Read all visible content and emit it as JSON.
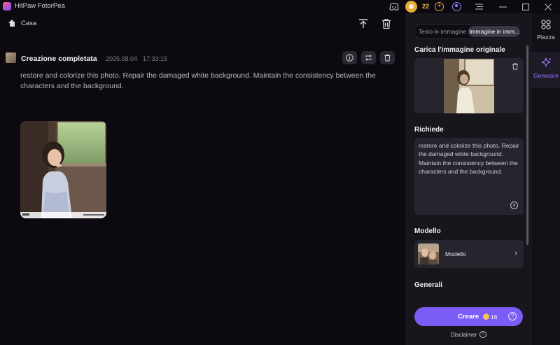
{
  "window": {
    "title": "HitPaw FotorPea",
    "credits": "22"
  },
  "breadcrumb": {
    "home_label": "Casa"
  },
  "generation": {
    "title": "Creazione completata",
    "date": "2025.08.04",
    "time": "17:33:15",
    "prompt": "restore and colorize this photo. Repair the damaged white background. Maintain the consistency between the characters and the background."
  },
  "panel": {
    "tabs": [
      {
        "label": "Testo in immagine",
        "active": false
      },
      {
        "label": "Immagine in imm...",
        "active": true
      }
    ],
    "upload_title": "Carica l'immagine originale",
    "prompt_title": "Richiede",
    "prompt_text": "restore and colorize this photo. Repair the damaged white background. Maintain the consistency between the characters and the background.",
    "model_title": "Modello",
    "model_label": "Modello",
    "general_title": "Generali",
    "create_label": "Creare",
    "create_cost": "16",
    "disclaimer": "Disclaimer"
  },
  "rail": {
    "items": [
      {
        "label": "Piazza",
        "active": false
      },
      {
        "label": "Generare",
        "active": true
      }
    ]
  },
  "colors": {
    "accent": "#7c5cf6",
    "coin": "#e9a93a",
    "background": "#0c0a10",
    "panel": "#18161d"
  }
}
